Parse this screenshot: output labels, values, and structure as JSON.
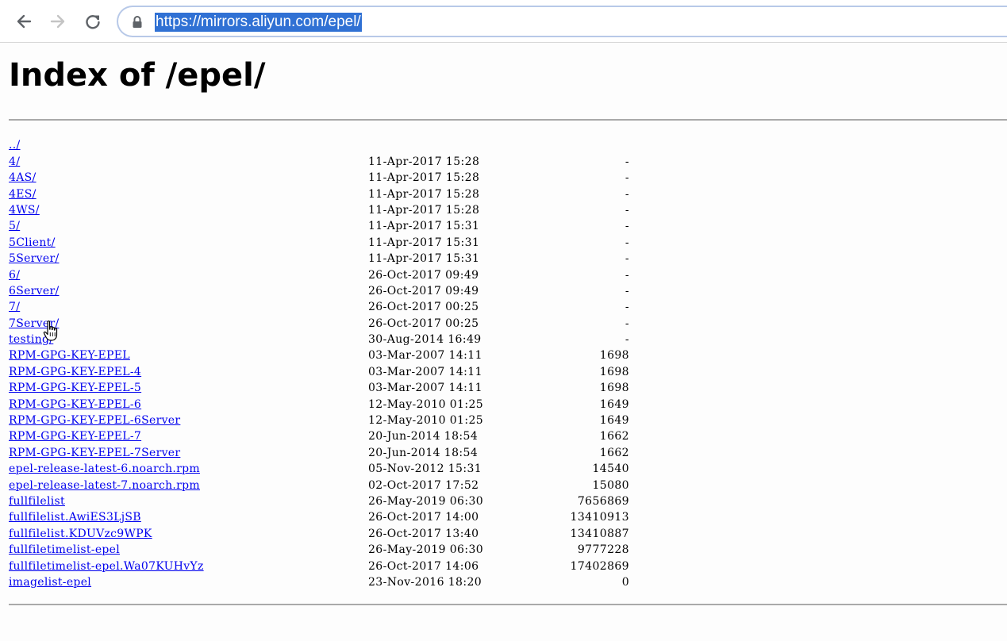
{
  "browser": {
    "url": "https://mirrors.aliyun.com/epel/"
  },
  "page": {
    "title": "Index of /epel/"
  },
  "parent_link": "../",
  "entries": [
    {
      "name": "4/",
      "date": "11-Apr-2017 15:28",
      "size": "-"
    },
    {
      "name": "4AS/",
      "date": "11-Apr-2017 15:28",
      "size": "-"
    },
    {
      "name": "4ES/",
      "date": "11-Apr-2017 15:28",
      "size": "-"
    },
    {
      "name": "4WS/",
      "date": "11-Apr-2017 15:28",
      "size": "-"
    },
    {
      "name": "5/",
      "date": "11-Apr-2017 15:31",
      "size": "-"
    },
    {
      "name": "5Client/",
      "date": "11-Apr-2017 15:31",
      "size": "-"
    },
    {
      "name": "5Server/",
      "date": "11-Apr-2017 15:31",
      "size": "-"
    },
    {
      "name": "6/",
      "date": "26-Oct-2017 09:49",
      "size": "-"
    },
    {
      "name": "6Server/",
      "date": "26-Oct-2017 09:49",
      "size": "-"
    },
    {
      "name": "7/",
      "date": "26-Oct-2017 00:25",
      "size": "-"
    },
    {
      "name": "7Server/",
      "date": "26-Oct-2017 00:25",
      "size": "-"
    },
    {
      "name": "testing/",
      "date": "30-Aug-2014 16:49",
      "size": "-"
    },
    {
      "name": "RPM-GPG-KEY-EPEL",
      "date": "03-Mar-2007 14:11",
      "size": "1698"
    },
    {
      "name": "RPM-GPG-KEY-EPEL-4",
      "date": "03-Mar-2007 14:11",
      "size": "1698"
    },
    {
      "name": "RPM-GPG-KEY-EPEL-5",
      "date": "03-Mar-2007 14:11",
      "size": "1698"
    },
    {
      "name": "RPM-GPG-KEY-EPEL-6",
      "date": "12-May-2010 01:25",
      "size": "1649"
    },
    {
      "name": "RPM-GPG-KEY-EPEL-6Server",
      "date": "12-May-2010 01:25",
      "size": "1649"
    },
    {
      "name": "RPM-GPG-KEY-EPEL-7",
      "date": "20-Jun-2014 18:54",
      "size": "1662"
    },
    {
      "name": "RPM-GPG-KEY-EPEL-7Server",
      "date": "20-Jun-2014 18:54",
      "size": "1662"
    },
    {
      "name": "epel-release-latest-6.noarch.rpm",
      "date": "05-Nov-2012 15:31",
      "size": "14540"
    },
    {
      "name": "epel-release-latest-7.noarch.rpm",
      "date": "02-Oct-2017 17:52",
      "size": "15080"
    },
    {
      "name": "fullfilelist",
      "date": "26-May-2019 06:30",
      "size": "7656869"
    },
    {
      "name": "fullfilelist.AwiES3LjSB",
      "date": "26-Oct-2017 14:00",
      "size": "13410913"
    },
    {
      "name": "fullfilelist.KDUVzc9WPK",
      "date": "26-Oct-2017 13:40",
      "size": "13410887"
    },
    {
      "name": "fullfiletimelist-epel",
      "date": "26-May-2019 06:30",
      "size": "9777228"
    },
    {
      "name": "fullfiletimelist-epel.Wa07KUHvYz",
      "date": "26-Oct-2017 14:06",
      "size": "17402869"
    },
    {
      "name": "imagelist-epel",
      "date": "23-Nov-2016 18:20",
      "size": "0"
    }
  ],
  "icons": {
    "back": "arrow-left-icon",
    "forward": "arrow-right-icon",
    "reload": "reload-icon",
    "secure": "lock-icon",
    "cursor": "hand-pointer-icon"
  },
  "colors": {
    "link": "#0000ee",
    "url_selection": "#3071d4",
    "omnibox_border": "#b8c9e8"
  }
}
